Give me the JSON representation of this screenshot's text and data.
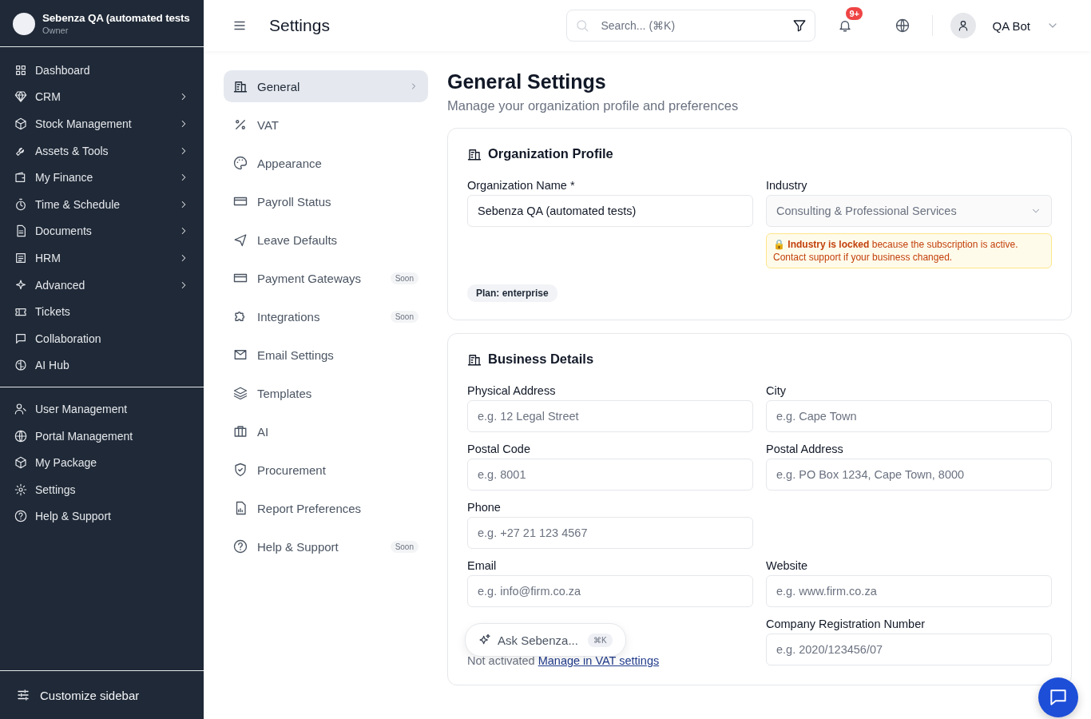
{
  "org": {
    "name": "Sebenza QA (automated tests",
    "role": "Owner"
  },
  "sidebar": {
    "items": [
      {
        "label": "Dashboard",
        "expandable": false
      },
      {
        "label": "CRM",
        "expandable": true
      },
      {
        "label": "Stock Management",
        "expandable": true
      },
      {
        "label": "Assets & Tools",
        "expandable": true
      },
      {
        "label": "My Finance",
        "expandable": true
      },
      {
        "label": "Time & Schedule",
        "expandable": true
      },
      {
        "label": "Documents",
        "expandable": true
      },
      {
        "label": "HRM",
        "expandable": true
      },
      {
        "label": "Advanced",
        "expandable": true
      },
      {
        "label": "Tickets",
        "expandable": false
      },
      {
        "label": "Collaboration",
        "expandable": false
      },
      {
        "label": "AI Hub",
        "expandable": false
      }
    ],
    "bottom_items": [
      {
        "label": "User Management"
      },
      {
        "label": "Portal Management"
      },
      {
        "label": "My Package"
      },
      {
        "label": "Settings"
      },
      {
        "label": "Help & Support"
      }
    ],
    "customize": "Customize sidebar"
  },
  "topbar": {
    "title": "Settings",
    "search": {
      "placeholder": "Search... (⌘K)"
    },
    "notification_badge": "9+",
    "user": "QA Bot"
  },
  "settings_nav": [
    {
      "label": "General",
      "selected": true
    },
    {
      "label": "VAT",
      "selected": false
    },
    {
      "label": "Appearance",
      "selected": false
    },
    {
      "label": "Payroll Status",
      "selected": false
    },
    {
      "label": "Leave Defaults",
      "selected": false
    },
    {
      "label": "Payment Gateways",
      "selected": false,
      "badge": "Soon"
    },
    {
      "label": "Integrations",
      "selected": false,
      "badge": "Soon"
    },
    {
      "label": "Email Settings",
      "selected": false
    },
    {
      "label": "Templates",
      "selected": false
    },
    {
      "label": "AI",
      "selected": false
    },
    {
      "label": "Procurement",
      "selected": false
    },
    {
      "label": "Report Preferences",
      "selected": false
    },
    {
      "label": "Help & Support",
      "selected": false,
      "badge": "Soon"
    }
  ],
  "page": {
    "title": "General Settings",
    "subtitle": "Manage your organization profile and preferences"
  },
  "org_profile": {
    "title": "Organization Profile",
    "name_field": {
      "label": "Organization Name *",
      "value": "Sebenza QA (automated tests)"
    },
    "industry_field": {
      "label": "Industry",
      "value": "Consulting & Professional Services",
      "disabled": true
    },
    "lock_notice": "🔒 **Industry is locked** because the subscription is active. Contact support if your business changed.",
    "plan": "Plan: enterprise"
  },
  "business_details": {
    "title": "Business Details",
    "rows": [
      [
        {
          "kind": "input",
          "label": "Physical Address",
          "placeholder": "e.g. 12 Legal Street"
        },
        {
          "kind": "input",
          "label": "City",
          "placeholder": "e.g. Cape Town"
        }
      ],
      [
        {
          "kind": "input",
          "label": "Postal Code",
          "placeholder": "e.g. 8001"
        },
        {
          "kind": "input",
          "label": "Postal Address",
          "placeholder": "e.g. PO Box 1234, Cape Town, 8000"
        }
      ],
      [
        {
          "kind": "input",
          "label": "Phone",
          "placeholder": "e.g. +27 21 123 4567"
        }
      ],
      [
        {
          "kind": "input",
          "label": "Email",
          "placeholder": "e.g. info@firm.co.za"
        },
        {
          "kind": "input",
          "label": "Website",
          "placeholder": "e.g. www.firm.co.za"
        }
      ],
      [
        {
          "kind": "note",
          "text": "Not activated",
          "link": "Manage in VAT settings"
        },
        {
          "kind": "input",
          "label": "Company Registration Number",
          "placeholder": "e.g. 2020/123456/07"
        }
      ]
    ]
  },
  "assistant": {
    "label": "Ask Sebenza...",
    "shortcut": "⌘K"
  }
}
